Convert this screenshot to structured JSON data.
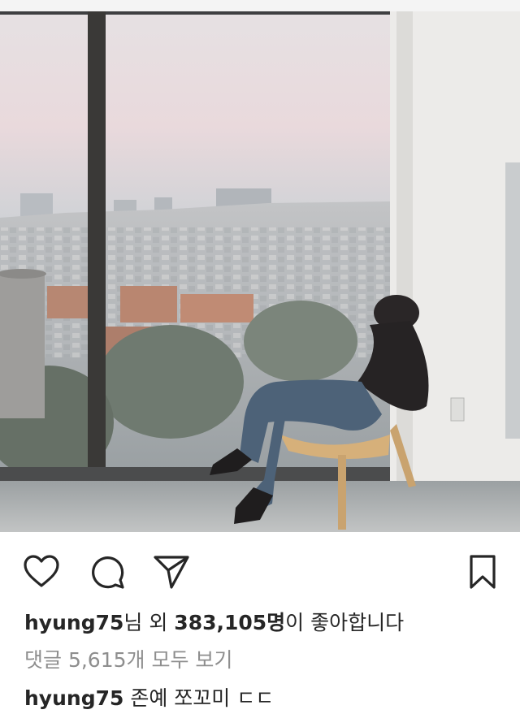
{
  "post": {
    "photo_label": "post-photo",
    "likes": {
      "first_liker": "hyung75",
      "mid_text": "님 외 ",
      "count": "383,105명",
      "tail_text": "이 좋아합니다"
    },
    "comments_link": "댓글 5,615개 모두 보기",
    "caption": {
      "username": "hyung75",
      "text": " 존예 쪼꼬미 ㄷㄷ"
    }
  },
  "icons": {
    "like": "heart-icon",
    "comment": "comment-bubble-icon",
    "share": "paper-plane-icon",
    "save": "bookmark-icon"
  },
  "colors": {
    "text": "#262626",
    "muted": "#8e8e8e",
    "icon": "#262626"
  }
}
